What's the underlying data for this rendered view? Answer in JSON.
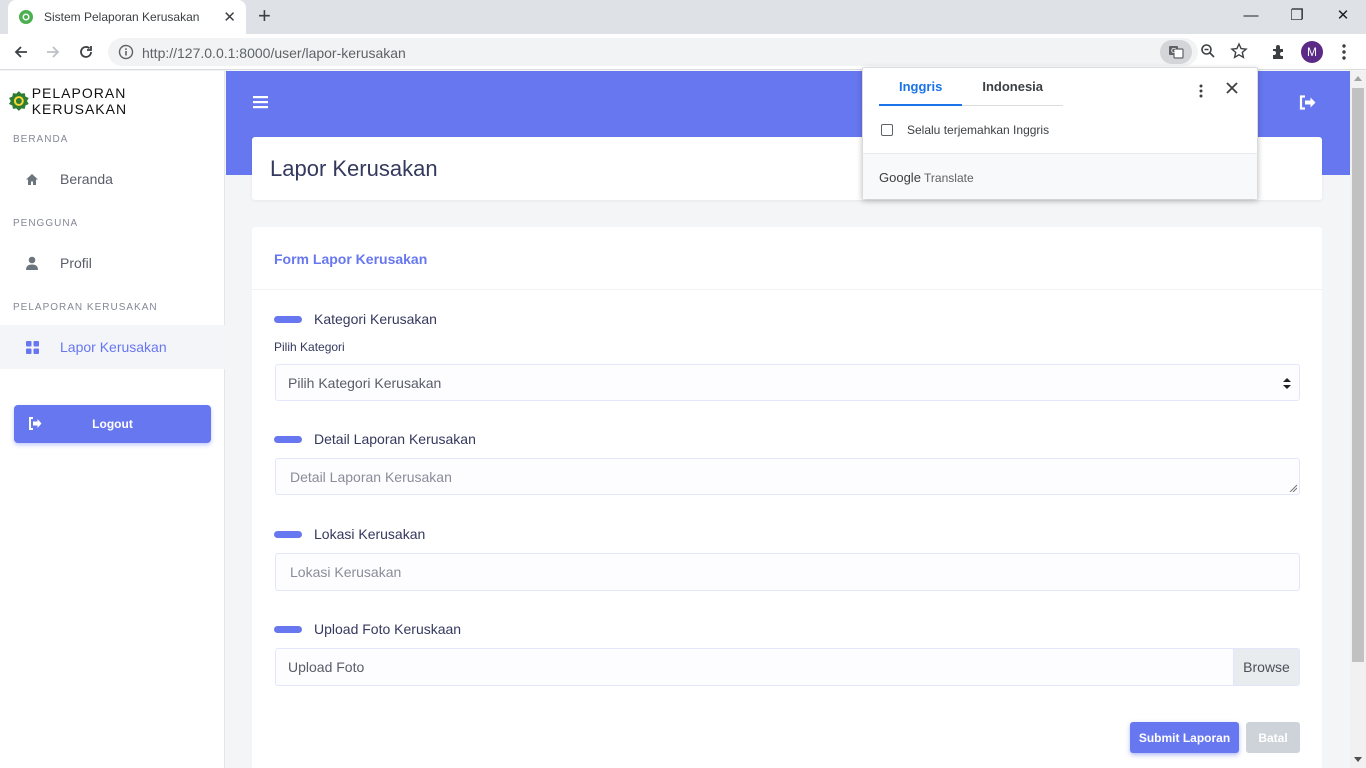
{
  "browser": {
    "tab_title": "Sistem Pelaporan Kerusakan",
    "url": "http://127.0.0.1:8000/user/lapor-kerusakan",
    "profile_initial": "M"
  },
  "sidebar": {
    "brand": "PELAPORAN KERUSAKAN",
    "sections": [
      {
        "heading": "BERANDA",
        "item": "Beranda",
        "icon": "home-icon"
      },
      {
        "heading": "PENGGUNA",
        "item": "Profil",
        "icon": "user-icon"
      },
      {
        "heading": "PELAPORAN KERUSAKAN",
        "item": "Lapor Kerusakan",
        "icon": "grid-icon"
      }
    ],
    "logout_label": "Logout"
  },
  "page": {
    "title": "Lapor Kerusakan",
    "form_title": "Form Lapor Kerusakan",
    "groups": {
      "kategori": {
        "label": "Kategori Kerusakan",
        "sublabel": "Pilih Kategori",
        "selected": "Pilih Kategori Kerusakan"
      },
      "detail": {
        "label": "Detail Laporan Kerusakan",
        "placeholder": "Detail Laporan Kerusakan"
      },
      "lokasi": {
        "label": "Lokasi Kerusakan",
        "placeholder": "Lokasi Kerusakan"
      },
      "foto": {
        "label": "Upload Foto Keruskaan",
        "placeholder": "Upload Foto",
        "browse": "Browse"
      }
    },
    "submit_label": "Submit Laporan",
    "cancel_label": "Batal"
  },
  "translate_popup": {
    "tabs": [
      "Inggris",
      "Indonesia"
    ],
    "active_tab": "Inggris",
    "always_translate": "Selalu terjemahkan Inggris",
    "footer_google": "Google",
    "footer_translate": "Translate"
  },
  "colors": {
    "accent": "#6777ef",
    "google_blue": "#1a73e8"
  }
}
